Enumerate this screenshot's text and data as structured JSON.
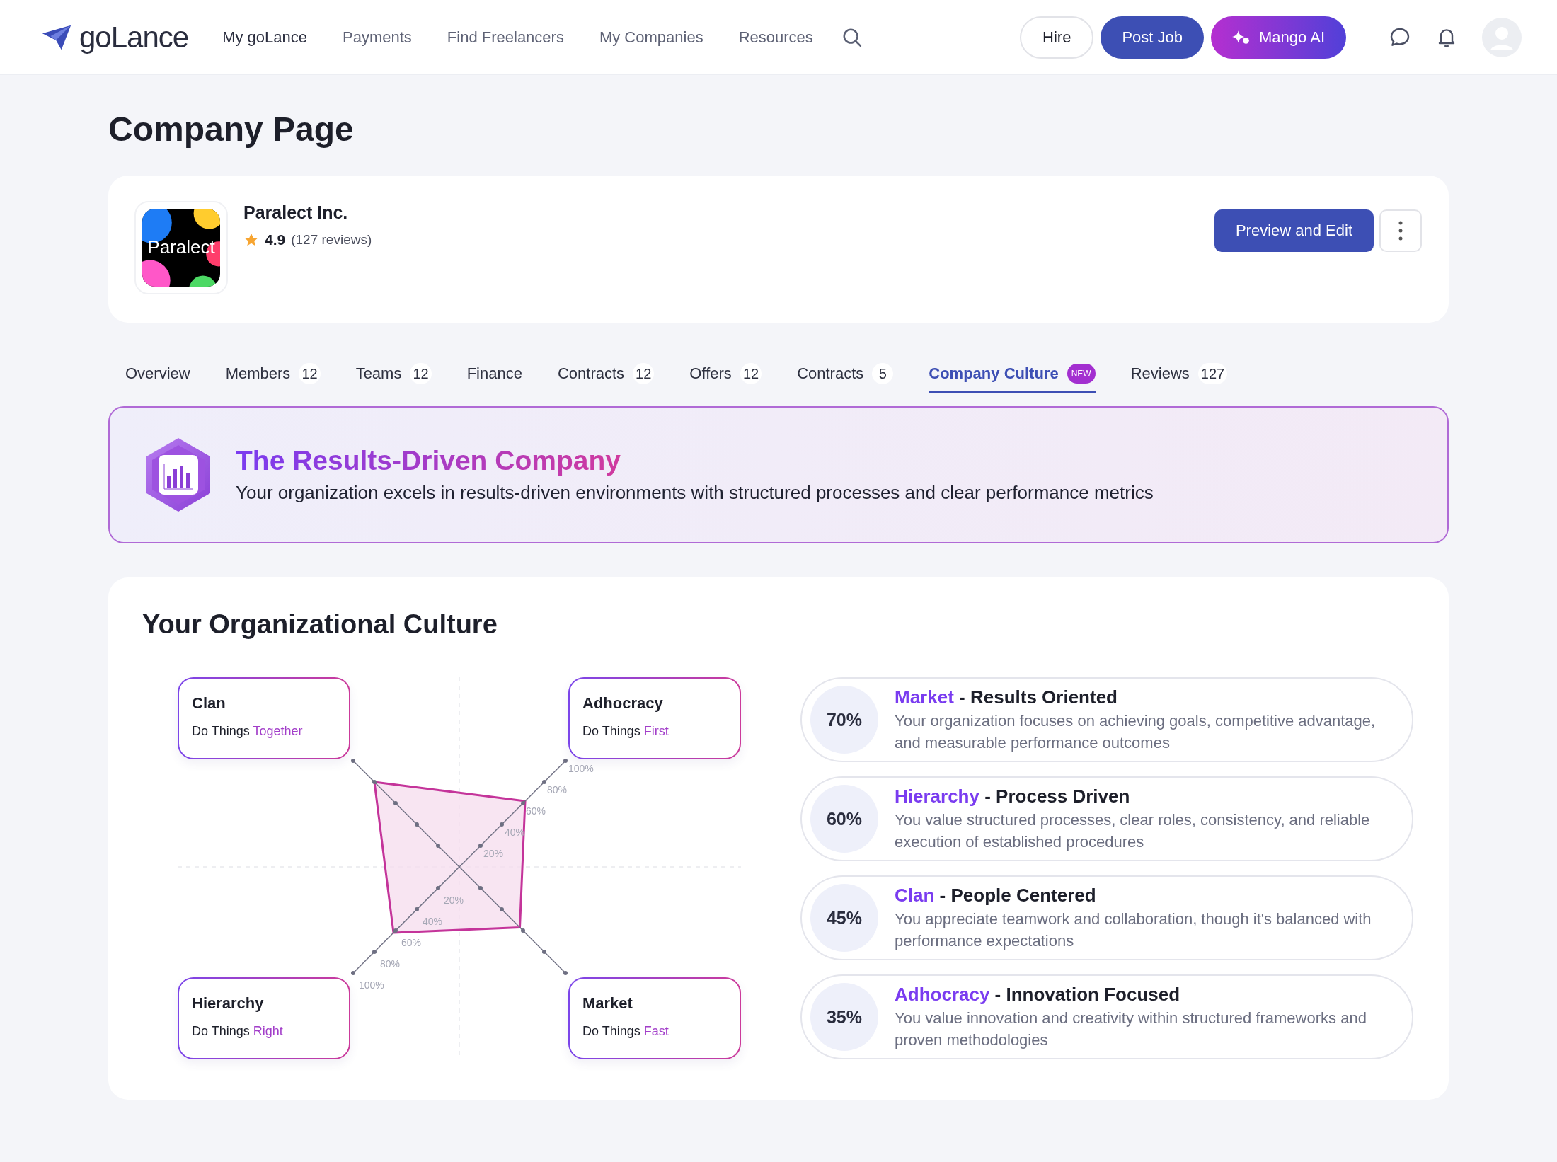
{
  "header": {
    "logo": "goLance",
    "nav": [
      {
        "label": "My goLance",
        "selected": true
      },
      {
        "label": "Payments",
        "selected": false
      },
      {
        "label": "Find Freelancers",
        "selected": false
      },
      {
        "label": "My Companies",
        "selected": false
      },
      {
        "label": "Resources",
        "selected": false
      }
    ],
    "buttons": [
      {
        "label": "Hire",
        "kind": "outline"
      },
      {
        "label": "Post Job",
        "kind": "primary"
      },
      {
        "label": "Mango AI",
        "kind": "ai"
      }
    ]
  },
  "page_title": "Company Page",
  "company": {
    "logo_text": "Paralect",
    "name": "Paralect Inc.",
    "rating": "4.9",
    "reviews": "(127 reviews)",
    "action": "Preview and Edit"
  },
  "tabs": [
    {
      "label": "Overview",
      "selected": false
    },
    {
      "label": "Members",
      "count": "12",
      "selected": false
    },
    {
      "label": "Teams",
      "count": "12",
      "selected": false
    },
    {
      "label": "Finance",
      "selected": false
    },
    {
      "label": "Contracts",
      "count": "12",
      "selected": false
    },
    {
      "label": "Offers",
      "count": "12",
      "selected": false
    },
    {
      "label": "Contracts",
      "count": "5",
      "selected": false
    },
    {
      "label": "Company Culture",
      "badge": "NEW",
      "selected": true
    },
    {
      "label": "Reviews",
      "count": "127",
      "selected": false
    }
  ],
  "banner": {
    "title": "The Results-Driven Company",
    "description": "Your organization excels in results-driven environments with structured processes and clear performance metrics"
  },
  "culture": {
    "title": "Your Organizational Culture",
    "quadrants": [
      {
        "name": "Clan",
        "motto": "Do Things",
        "highlight": "Together"
      },
      {
        "name": "Adhocracy",
        "motto": "Do Things",
        "highlight": "First"
      },
      {
        "name": "Hierarchy",
        "motto": "Do Things",
        "highlight": "Right"
      },
      {
        "name": "Market",
        "motto": "Do Things",
        "highlight": "Fast"
      }
    ],
    "ticks_upper": [
      "20%",
      "40%",
      "60%",
      "80%",
      "100%"
    ],
    "ticks_lower": [
      "20%",
      "40%",
      "60%",
      "80%",
      "100%"
    ],
    "profiles": [
      {
        "percent": "70%",
        "type": "Market",
        "heading": "- Results Oriented",
        "description": "Your organization focuses on achieving goals, competitive advantage, and measurable performance outcomes"
      },
      {
        "percent": "60%",
        "type": "Hierarchy",
        "heading": "- Process Driven",
        "description": "You value structured processes, clear roles, consistency, and reliable execution of established procedures"
      },
      {
        "percent": "45%",
        "type": "Clan",
        "heading": "- People Centered",
        "description": "You appreciate teamwork and collaboration, though it's balanced with performance expectations"
      },
      {
        "percent": "35%",
        "type": "Adhocracy",
        "heading": "- Innovation Focused",
        "description": "You value innovation and creativity within structured frameworks and proven methodologies"
      }
    ]
  }
}
